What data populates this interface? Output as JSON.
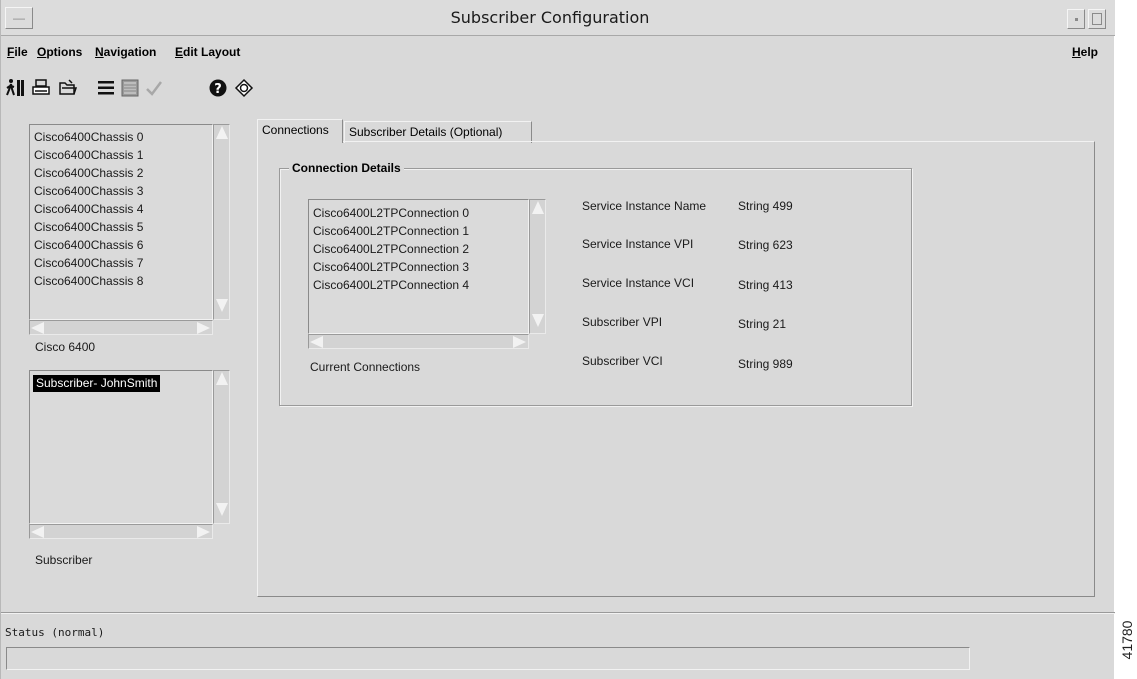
{
  "window": {
    "title": "Subscriber Configuration"
  },
  "menubar": {
    "file": "File",
    "options": "Options",
    "navigation": "Navigation",
    "edit_layout": "Edit Layout",
    "help": "Help"
  },
  "toolbar": {
    "icons": [
      "exit-icon",
      "print-icon",
      "open-folder-icon",
      "list-icon",
      "details-icon",
      "checkmark-icon",
      "help-icon",
      "refresh-icon"
    ]
  },
  "chassis_list": {
    "items": [
      "Cisco6400Chassis 0",
      "Cisco6400Chassis 1",
      "Cisco6400Chassis 2",
      "Cisco6400Chassis 3",
      "Cisco6400Chassis 4",
      "Cisco6400Chassis 5",
      "Cisco6400Chassis 6",
      "Cisco6400Chassis 7",
      "Cisco6400Chassis 8"
    ],
    "caption": "Cisco 6400"
  },
  "subscriber_list": {
    "items": [
      "Subscriber- JohnSmith"
    ],
    "selected_index": 0,
    "caption": "Subscriber"
  },
  "tabs": [
    {
      "label": "Connections",
      "active": true
    },
    {
      "label": "Subscriber Details (Optional)",
      "active": false
    }
  ],
  "connection_details": {
    "title": "Connection Details",
    "connections": [
      "Cisco6400L2TPConnection 0",
      "Cisco6400L2TPConnection 1",
      "Cisco6400L2TPConnection 2",
      "Cisco6400L2TPConnection 3",
      "Cisco6400L2TPConnection 4"
    ],
    "connections_caption": "Current Connections",
    "fields": [
      {
        "label": "Service Instance Name",
        "value": "String 499"
      },
      {
        "label": "Service Instance VPI",
        "value": "String 623"
      },
      {
        "label": "Service Instance VCI",
        "value": "String 413"
      },
      {
        "label": "Subscriber VPI",
        "value": "String 21"
      },
      {
        "label": "Subscriber VCI",
        "value": "String 989"
      }
    ]
  },
  "status": {
    "label": "Status (normal)",
    "value": ""
  },
  "figure_id": "41780"
}
